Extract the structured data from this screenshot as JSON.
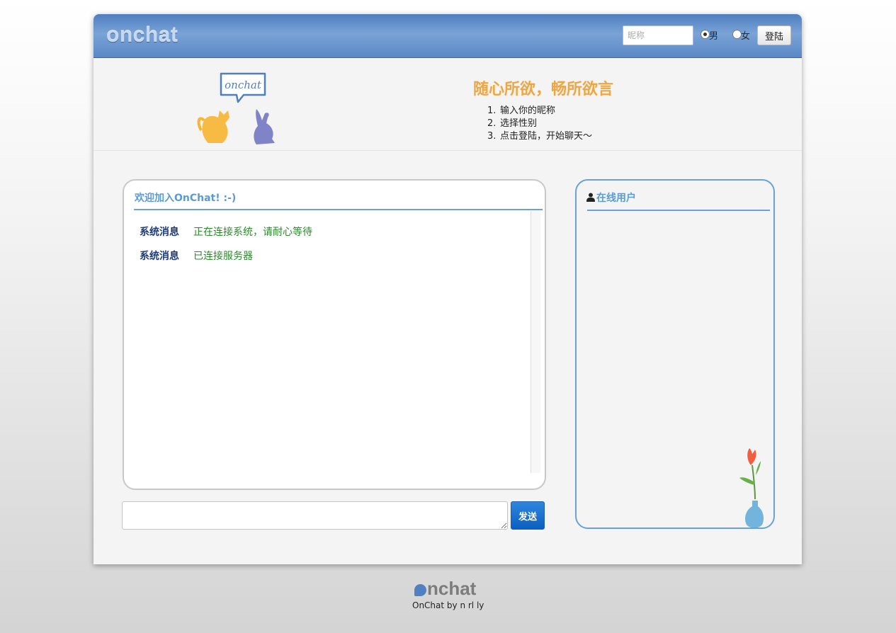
{
  "header": {
    "brand": "onchat",
    "nickname_placeholder": "昵称",
    "nickname_value": "",
    "gender_options": [
      {
        "label": "男",
        "selected": true
      },
      {
        "label": "女",
        "selected": false
      }
    ],
    "login_label": "登陆"
  },
  "hero": {
    "mascot_sign": "onchat",
    "slogan": "随心所欲，畅所欲言",
    "steps": [
      {
        "num": "1.",
        "text": "输入你的昵称"
      },
      {
        "num": "2.",
        "text": "选择性别"
      },
      {
        "num": "3.",
        "text": "点击登陆，开始聊天～"
      }
    ]
  },
  "chat": {
    "title": "欢迎加入OnChat! :-)",
    "messages": [
      {
        "sender": "系统消息",
        "text": "正在连接系统，请耐心等待"
      },
      {
        "sender": "系统消息",
        "text": "已连接服务器"
      }
    ],
    "input_value": "",
    "send_label": "发送"
  },
  "users": {
    "title": "在线用户",
    "icon": "user-icon",
    "list": []
  },
  "footer": {
    "logo_text": "nchat",
    "credit": "OnChat by n rl ly"
  },
  "colors": {
    "accent_blue": "#5b9bd5",
    "slogan_orange": "#f0a640",
    "sender_navy": "#1e3b7a",
    "message_green": "#2a8a2a",
    "send_button": "#0b5fc0"
  }
}
